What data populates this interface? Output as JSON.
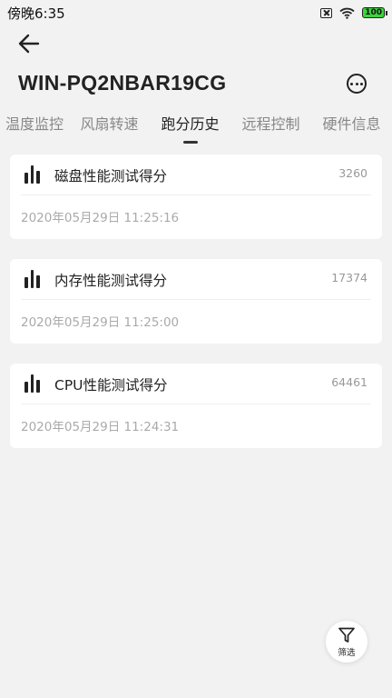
{
  "status_bar": {
    "time": "傍晚6:35",
    "battery": "100"
  },
  "header": {
    "device_name": "WIN-PQ2NBAR19CG"
  },
  "tabs": [
    {
      "label": "温度监控",
      "active": false
    },
    {
      "label": "风扇转速",
      "active": false
    },
    {
      "label": "跑分历史",
      "active": true
    },
    {
      "label": "远程控制",
      "active": false
    },
    {
      "label": "硬件信息",
      "active": false
    }
  ],
  "records": [
    {
      "title": "磁盘性能测试得分",
      "score": "3260",
      "time": "2020年05月29日 11:25:16"
    },
    {
      "title": "内存性能测试得分",
      "score": "17374",
      "time": "2020年05月29日 11:25:00"
    },
    {
      "title": "CPU性能测试得分",
      "score": "64461",
      "time": "2020年05月29日 11:24:31"
    }
  ],
  "filter": {
    "label": "筛选"
  }
}
